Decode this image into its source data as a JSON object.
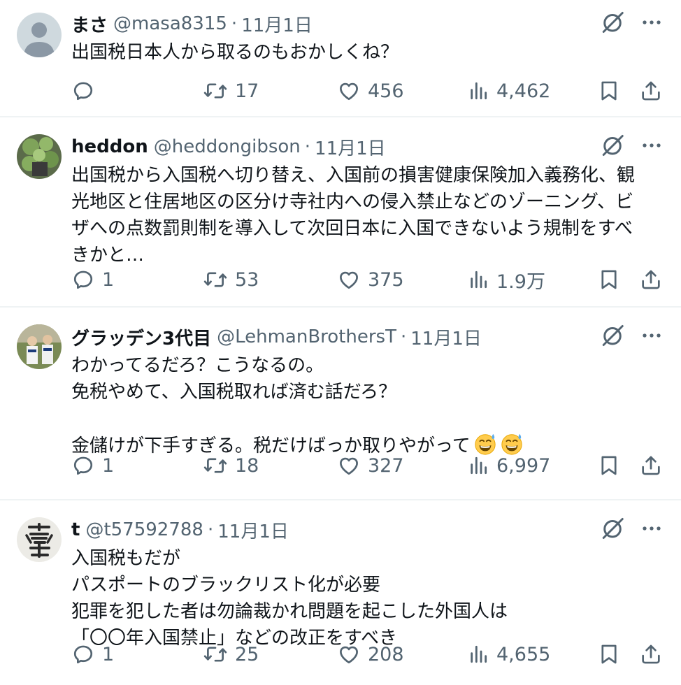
{
  "colors": {
    "text": "#0f1419",
    "muted": "#536471",
    "divider": "#eff3f4"
  },
  "tweets": [
    {
      "name": "まさ",
      "handle": "@masa8315",
      "dot": "·",
      "date": "11月1日",
      "text": "出国税日本人から取るのもおかしくね？",
      "replies": "",
      "retweets": "17",
      "likes": "456",
      "views": "4,462",
      "avatar": "default-avatar"
    },
    {
      "name": "heddon",
      "handle": "@heddongibson",
      "dot": "·",
      "date": "11月1日",
      "text": "出国税から入国税へ切り替え、入国前の損害健康保険加入義務化、観\n光地区と住居地区の区分け寺社内への侵入禁止などのゾーニング、ビ\nザへの点数罰則制を導入して次回日本に入国できないよう規制をすべ\nきかと…",
      "replies": "1",
      "retweets": "53",
      "likes": "375",
      "views": "1.9万",
      "avatar": "plant-photo"
    },
    {
      "name": "グラッデン3代目",
      "handle": "@LehmanBrothersT",
      "dot": "·",
      "date": "11月1日",
      "text": "わかってるだろ？こうなるの。\n免税やめて、入国税取れば済む話だろ？\n\n金儲けが下手すぎる。税だけばっか取りやがって",
      "emoji": [
        "grinning-sweat-emoji",
        "grinning-sweat-emoji"
      ],
      "replies": "1",
      "retweets": "18",
      "likes": "327",
      "views": "6,997",
      "avatar": "baseball-photo"
    },
    {
      "name": "t",
      "handle": "@t57592788",
      "dot": "·",
      "date": "11月1日",
      "text": "入国税もだが\nパスポートのブラックリスト化が必要\n犯罪を犯した者は勿論裁かれ問題を起こした外国人は\n「〇〇年入国禁止」などの改正をすべき",
      "replies": "1",
      "retweets": "25",
      "likes": "208",
      "views": "4,655",
      "avatar": "calligraphy-kanji"
    }
  ]
}
